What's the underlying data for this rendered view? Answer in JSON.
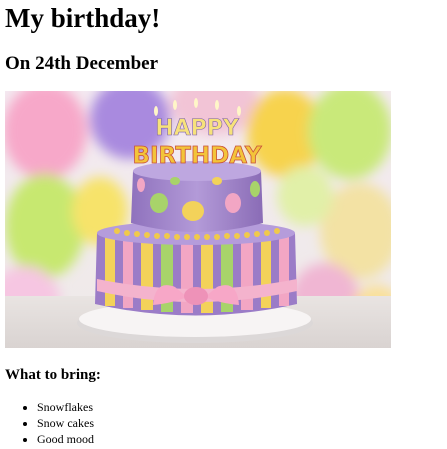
{
  "page": {
    "heading": "My birthday!",
    "subheading": "On 24th December"
  },
  "image": {
    "topper_line1": "HAPPY",
    "topper_line2": "BIRTHDAY"
  },
  "bring": {
    "title": "What to bring:",
    "items": [
      "Snowflakes",
      "Snow cakes",
      "Good mood"
    ]
  },
  "colors": {
    "background": "#ffffff",
    "text": "#000000",
    "cake_top": "#a98fcf",
    "cake_stripe_pink": "#f2a6c4",
    "cake_stripe_yellow": "#f3d25a",
    "cake_stripe_purple": "#9b7cc7",
    "cake_stripe_green": "#a8d36a",
    "plate": "#f5f2f2"
  }
}
